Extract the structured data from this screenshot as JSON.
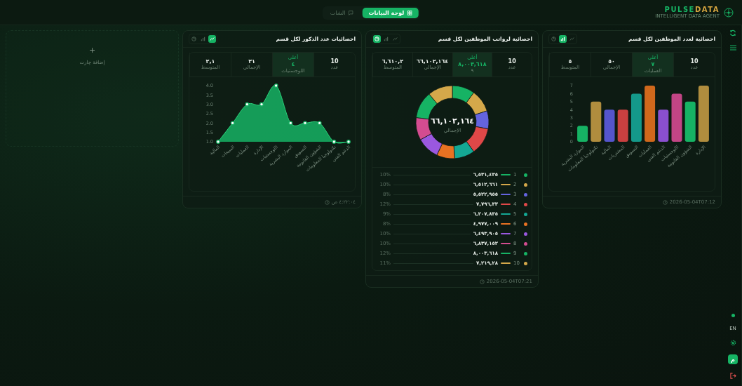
{
  "header": {
    "logo": {
      "first": "PULSE",
      "second": "DATA",
      "tagline": "INTELLIGENT DATA AGENT"
    },
    "tabs": [
      {
        "label": "لوحة البيانات",
        "selected": true
      },
      {
        "label": "الشات",
        "selected": false
      }
    ]
  },
  "cards": [
    {
      "title": "احصائية لعدد الموظفين لكل قسم",
      "view_toggles": [
        {
          "kind": "pie",
          "selected": false
        },
        {
          "kind": "bar",
          "selected": true
        },
        {
          "kind": "line",
          "selected": false
        }
      ],
      "stats": [
        {
          "value": "10",
          "label": "عدد",
          "selected": false
        },
        {
          "top": "أعلى",
          "value": "٧",
          "label": "العمليات",
          "selected": true
        },
        {
          "value": "٥٠",
          "label": "الإجمالي",
          "selected": false
        },
        {
          "value": "٥",
          "label": "المتوسط",
          "selected": false
        }
      ],
      "chart_data": {
        "type": "bar",
        "categories": [
          "الموارد البشرية",
          "تكنولوجيا المعلومات",
          "المالية",
          "المشتريات",
          "التسويق",
          "العمليات",
          "الدعم الفني",
          "اللوجستيات",
          "الشؤون القانونية",
          "الإدارة"
        ],
        "values": [
          2,
          5,
          4,
          4,
          6,
          7,
          4,
          6,
          5,
          7
        ],
        "ylim": [
          0,
          7
        ],
        "yticks": [
          0,
          1,
          2,
          3,
          4,
          5,
          6,
          7
        ]
      },
      "bars": [
        {
          "color": "#16b364"
        },
        {
          "color": "#b08d3e"
        },
        {
          "color": "#5555cc"
        },
        {
          "color": "#c94040"
        },
        {
          "color": "#14998a"
        },
        {
          "color": "#d0681c"
        },
        {
          "color": "#8a4fcf"
        },
        {
          "color": "#c24585"
        },
        {
          "color": "#16b364"
        },
        {
          "color": "#b08d3e"
        }
      ],
      "footer": "2026-05-04T07:12"
    },
    {
      "title": "احصائية لرواتب الموظفين لكل قسم",
      "view_toggles": [
        {
          "kind": "pie",
          "selected": true
        },
        {
          "kind": "bar",
          "selected": false
        },
        {
          "kind": "line",
          "selected": false
        }
      ],
      "stats": [
        {
          "value": "10",
          "label": "عدد",
          "selected": false
        },
        {
          "top": "أعلى",
          "value": "٨,٠٠٣,٦١٨",
          "label": "٩",
          "selected": true
        },
        {
          "value": "٦٦,١٠٢,١٦٤",
          "label": "الإجمالي",
          "selected": false
        },
        {
          "value": "٦,٦١٠,٢",
          "label": "المتوسط",
          "selected": false
        }
      ],
      "center": {
        "value": "٦٦,١٠٢,١٦٤",
        "label": "الإجمالي"
      },
      "chart_data": {
        "type": "donut",
        "values": [
          10,
          10,
          8,
          12,
          9,
          8,
          10,
          10,
          12,
          11
        ]
      },
      "legend": [
        {
          "index": "1",
          "value": "٦,٥٣١,٤٣٥",
          "percent": "10%",
          "color": "#16b364"
        },
        {
          "index": "2",
          "value": "٦,٥١٢,٦٦١",
          "percent": "10%",
          "color": "#d4a84a"
        },
        {
          "index": "3",
          "value": "٥,٥٢٢,٩٥٥",
          "percent": "8%",
          "color": "#6464e0"
        },
        {
          "index": "4",
          "value": "٧,٧٩٦,٣٣",
          "percent": "12%",
          "color": "#e04848"
        },
        {
          "index": "5",
          "value": "٦,٢٠٧,٨٣٥",
          "percent": "9%",
          "color": "#14a894"
        },
        {
          "index": "6",
          "value": "٤,٩٧٧,٠٠٩",
          "percent": "8%",
          "color": "#e87222"
        },
        {
          "index": "7",
          "value": "٦,٤٩٣,٩٠٥",
          "percent": "10%",
          "color": "#9a58e0"
        },
        {
          "index": "8",
          "value": "٦,٨٣٧,١٥٢",
          "percent": "10%",
          "color": "#d44c90"
        },
        {
          "index": "9",
          "value": "٨,٠٠٣,٦١٨",
          "percent": "12%",
          "color": "#16b364"
        },
        {
          "index": "10",
          "value": "٧,٢١٩,٢٨",
          "percent": "11%",
          "color": "#d4a84a"
        }
      ],
      "footer": "2026-05-04T07:21"
    },
    {
      "title": "احصائيات عدد الذكور لكل قسم",
      "view_toggles": [
        {
          "kind": "pie",
          "selected": false
        },
        {
          "kind": "bar",
          "selected": false
        },
        {
          "kind": "line",
          "selected": true
        }
      ],
      "stats": [
        {
          "value": "10",
          "label": "عدد",
          "selected": false
        },
        {
          "top": "أعلى",
          "value": "٤",
          "label": "اللوجستيات",
          "selected": true
        },
        {
          "value": "٢١",
          "label": "الإجمالي",
          "selected": false
        },
        {
          "value": "٢,١",
          "label": "المتوسط",
          "selected": false
        }
      ],
      "chart_data": {
        "type": "area",
        "categories": [
          "المالية",
          "المبيعات",
          "العمليات",
          "الإدارة",
          "اللوجستيات",
          "الموارد البشرية",
          "التسويق",
          "الشؤون القانونية",
          "تكنولوجيا المعلومات",
          "الدعم الفني"
        ],
        "values": [
          1,
          2,
          3,
          3,
          4,
          2,
          2,
          2,
          1,
          1
        ],
        "ylim": [
          1,
          4
        ],
        "yticks": [
          {
            "value": 1,
            "label": "1.0"
          },
          {
            "value": 1.5,
            "label": "1.5"
          },
          {
            "value": 2,
            "label": "2.0"
          },
          {
            "value": 2.5,
            "label": "2.5"
          },
          {
            "value": 3,
            "label": "3.0"
          },
          {
            "value": 3.5,
            "label": "3.5"
          },
          {
            "value": 4,
            "label": "4.0"
          }
        ]
      },
      "footer": "٤:٢٢:٠٤ ص"
    }
  ],
  "add_card": {
    "label": "إضافة چارت",
    "icon": "+"
  },
  "sidebar": {
    "language": "EN",
    "avatar": "م"
  }
}
